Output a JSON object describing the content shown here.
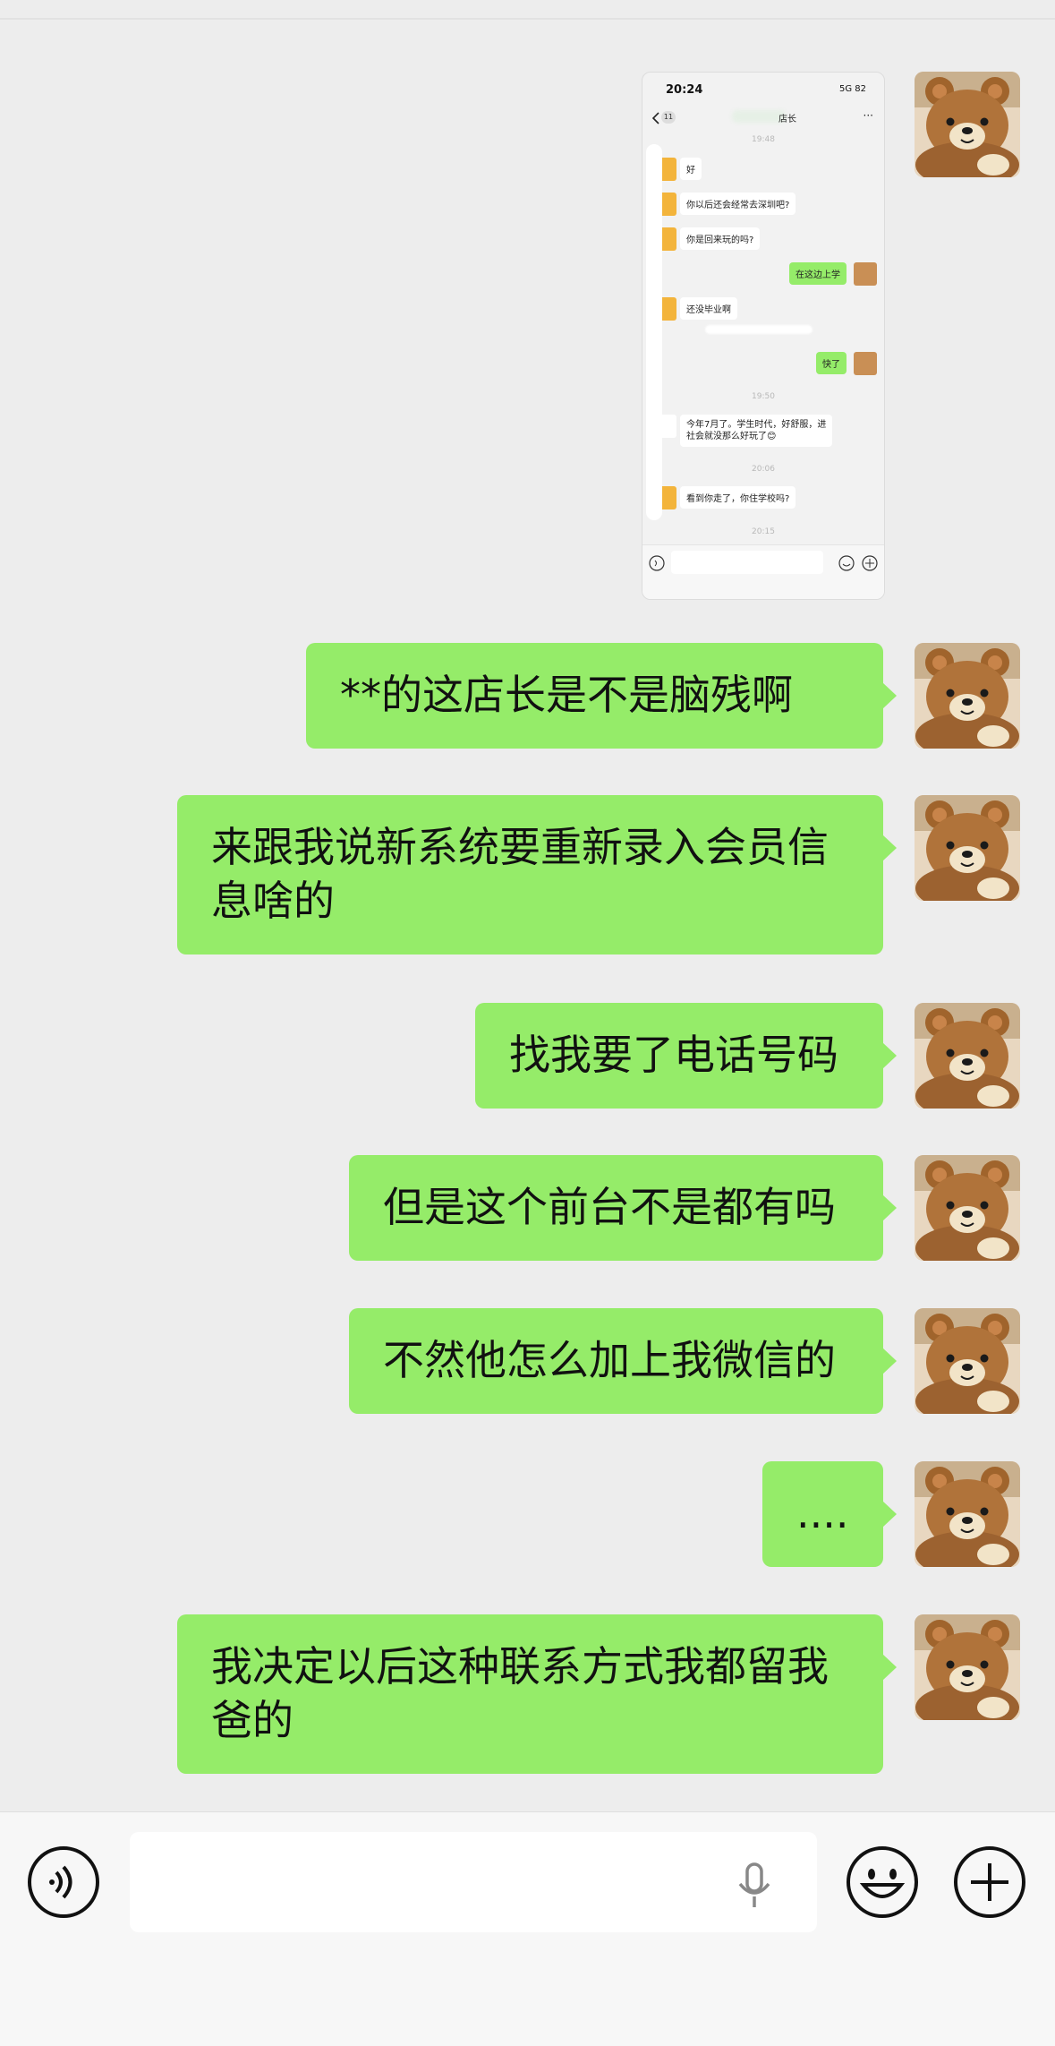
{
  "chat": {
    "messages": [
      {
        "text": "**的这店长是不是脑残啊"
      },
      {
        "text": "来跟我说新系统要重新录入会员信\n息啥的"
      },
      {
        "text": "找我要了电话号码"
      },
      {
        "text": "但是这个前台不是都有吗"
      },
      {
        "text": "不然他怎么加上我微信的"
      },
      {
        "text": "...."
      },
      {
        "text": "我决定以后这种联系方式我都留我\n爸的"
      }
    ]
  },
  "screenshot_msg": {
    "status_time": "20:24",
    "status_right": "5G 82",
    "back_count": "11",
    "title": "店长",
    "more": "···",
    "times": [
      "19:48",
      "19:50",
      "20:06",
      "20:15"
    ],
    "bubbles": [
      {
        "text": "好",
        "side": "left"
      },
      {
        "text": "你以后还会经常去深圳吧?",
        "side": "left"
      },
      {
        "text": "你是回来玩的吗?",
        "side": "left"
      },
      {
        "text": "在这边上学",
        "side": "right"
      },
      {
        "text": "还没毕业啊",
        "side": "left"
      },
      {
        "text": "快了",
        "side": "right"
      },
      {
        "text": "今年7月了。学生时代，好舒服，进\n社会就没那么好玩了😊",
        "side": "left"
      },
      {
        "text": "看到你走了，你住学校吗?",
        "side": "left"
      }
    ]
  },
  "input_bar": {
    "voice_icon": "voice-icon",
    "mic_icon": "microphone-icon",
    "emoji_icon": "emoji-icon",
    "plus_icon": "plus-icon"
  },
  "colors": {
    "bubble_green": "#95ec69",
    "background": "#ededed"
  }
}
